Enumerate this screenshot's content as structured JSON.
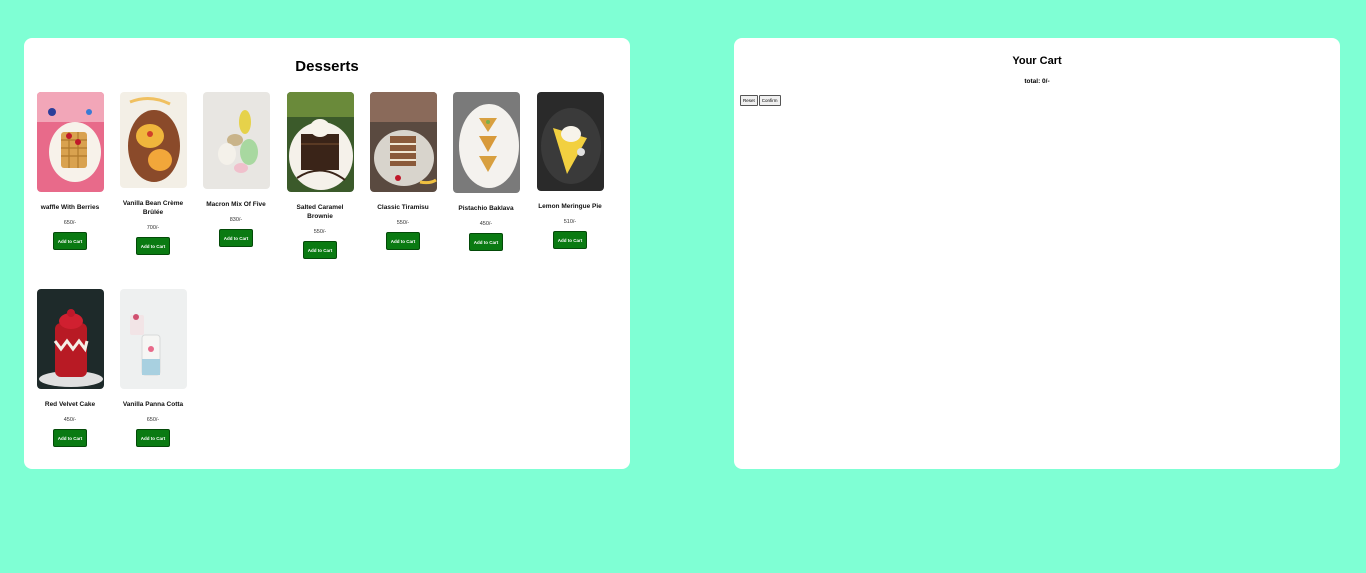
{
  "menu": {
    "title": "Desserts",
    "add_label": "Add to Cart",
    "items": [
      {
        "name": "waffle With Berries",
        "price": "650/-",
        "icon": "waffle-image"
      },
      {
        "name": "Vanilla Bean Crème Brûlée",
        "price": "700/-",
        "icon": "creme-brulee-image"
      },
      {
        "name": "Macron Mix Of Five",
        "price": "830/-",
        "icon": "macaron-image"
      },
      {
        "name": "Salted Caramel Brownie",
        "price": "550/-",
        "icon": "brownie-image"
      },
      {
        "name": "Classic Tiramisu",
        "price": "550/-",
        "icon": "tiramisu-image"
      },
      {
        "name": "Pistachio Baklava",
        "price": "450/-",
        "icon": "baklava-image"
      },
      {
        "name": "Lemon Meringue Pie",
        "price": "510/-",
        "icon": "lemon-pie-image"
      },
      {
        "name": "Red Velvet Cake",
        "price": "450/-",
        "icon": "red-velvet-image"
      },
      {
        "name": "Vanilla Panna Cotta",
        "price": "650/-",
        "icon": "panna-cotta-image"
      }
    ]
  },
  "cart": {
    "title": "Your Cart",
    "total": "total: 0/-",
    "reset_label": "Reset",
    "confirm_label": "Confirm"
  },
  "colors": {
    "background": "#7fffd4",
    "button": "#0a7a12"
  }
}
